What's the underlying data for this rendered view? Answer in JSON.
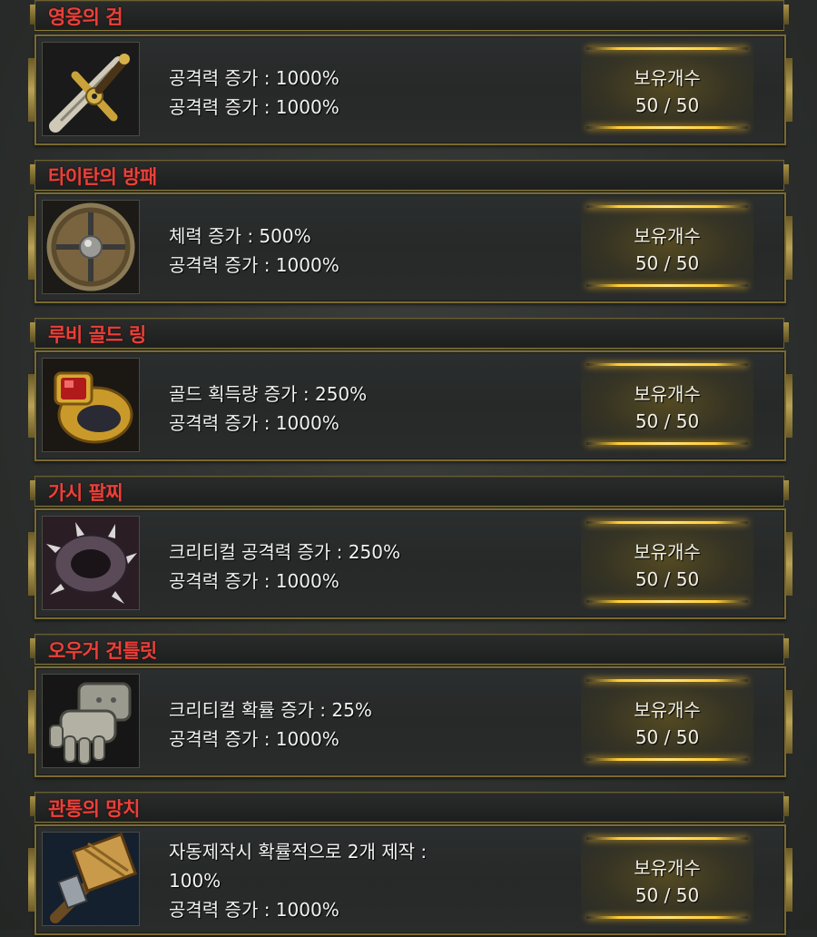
{
  "items": [
    {
      "name": "영웅의 검",
      "icon": "sword-icon",
      "stats": [
        "공격력 증가 : 1000%",
        "공격력 증가 : 1000%"
      ],
      "count_label": "보유개수",
      "count_value": "50 / 50"
    },
    {
      "name": "타이탄의 방패",
      "icon": "shield-icon",
      "stats": [
        "체력 증가 : 500%",
        "공격력 증가 : 1000%"
      ],
      "count_label": "보유개수",
      "count_value": "50 / 50"
    },
    {
      "name": "루비 골드 링",
      "icon": "ring-icon",
      "stats": [
        "골드 획득량 증가 : 250%",
        "공격력 증가 : 1000%"
      ],
      "count_label": "보유개수",
      "count_value": "50 / 50"
    },
    {
      "name": "가시 팔찌",
      "icon": "spiked-bracelet-icon",
      "stats": [
        "크리티컬 공격력 증가 : 250%",
        "공격력 증가 : 1000%"
      ],
      "count_label": "보유개수",
      "count_value": "50 / 50"
    },
    {
      "name": "오우거 건틀릿",
      "icon": "gauntlet-icon",
      "stats": [
        "크리티컬 확률 증가 : 25%",
        "공격력 증가 : 1000%"
      ],
      "count_label": "보유개수",
      "count_value": "50 / 50"
    },
    {
      "name": "관통의 망치",
      "icon": "hammer-icon",
      "stats": [
        "자동제작시 확률적으로 2개 제작 :",
        "100%",
        "공격력 증가 : 1000%"
      ],
      "count_label": "보유개수",
      "count_value": "50 / 50"
    }
  ],
  "colors": {
    "title": "#e8413a",
    "frame_gold": "#7a6a30",
    "glow_gold": "#ffcc33"
  }
}
